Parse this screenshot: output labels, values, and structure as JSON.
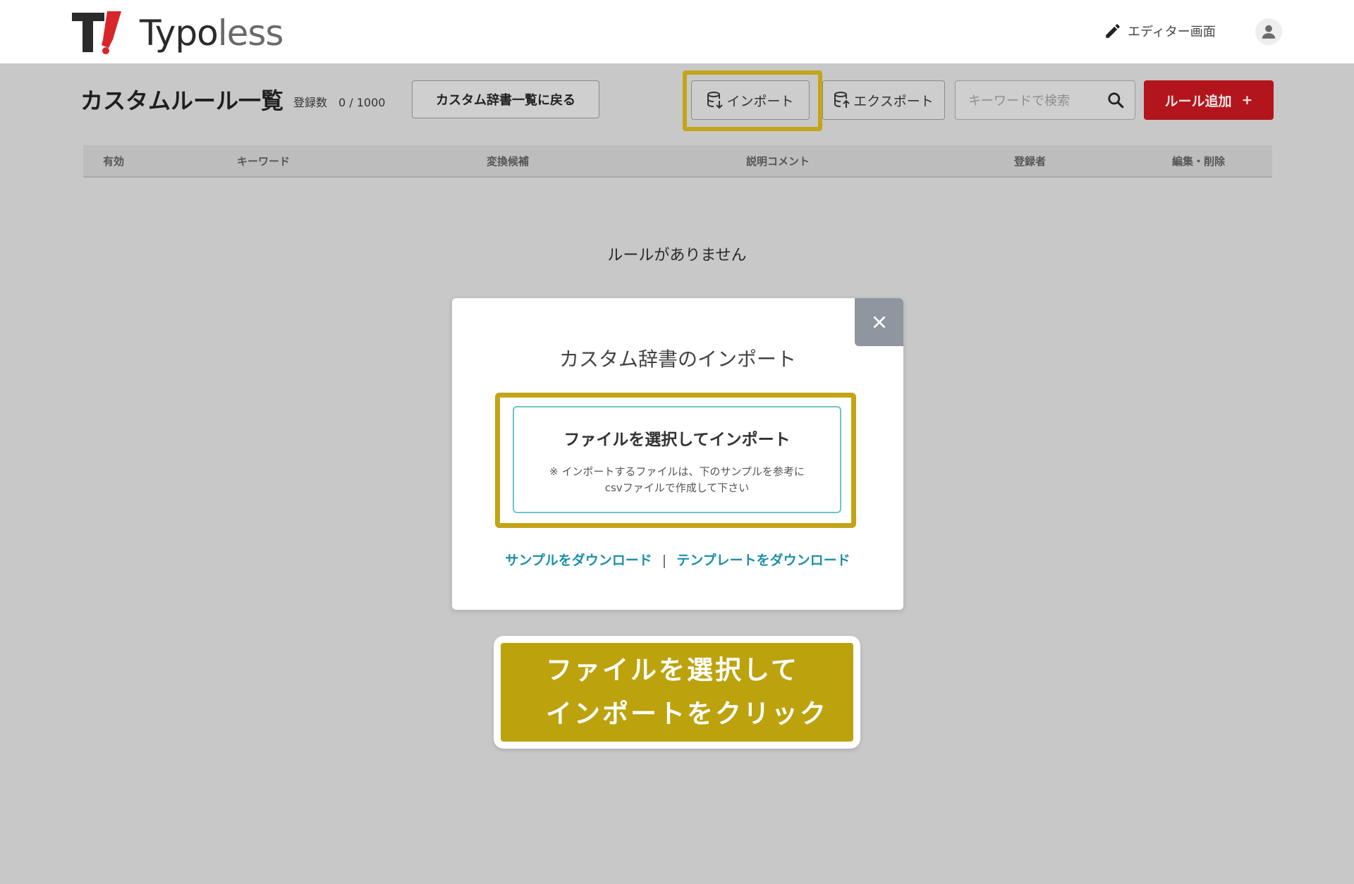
{
  "header": {
    "logo_text_bold": "Typo",
    "logo_text_light": "less",
    "editor_link_label": "エディター画面",
    "icons": {
      "editor": "pencil-icon",
      "account": "user-icon"
    }
  },
  "toolbar": {
    "page_title": "カスタムルール一覧",
    "registered_count": "登録数　0 / 1000",
    "back_button_label": "カスタム辞書一覧に戻る",
    "import_label": "インポート",
    "export_label": "エクスポート",
    "search_placeholder": "キーワードで検索",
    "add_rule_label": "ルール追加",
    "add_rule_plus": "+"
  },
  "table": {
    "columns": [
      "有効",
      "キーワード",
      "変換候補",
      "説明コメント",
      "登録者",
      "編集・削除"
    ],
    "empty_message": "ルールがありません"
  },
  "modal": {
    "title": "カスタム辞書のインポート",
    "file_button_title": "ファイルを選択してインポート",
    "file_button_note_line1": "※ インポートするファイルは、下のサンプルを参考に",
    "file_button_note_line2": "csvファイルで作成して下さい",
    "sample_download_label": "サンプルをダウンロード",
    "separator": "|",
    "template_download_label": "テンプレートをダウンロード",
    "close_icon": "close-icon"
  },
  "callout": {
    "line1": "ファイルを選択して",
    "line2": "インポートをクリック"
  },
  "colors": {
    "accent_red": "#b3151c",
    "highlight_gold": "#c4a418",
    "link_teal": "#1b8fa8",
    "overlay_gray": "#c8c8c8"
  }
}
